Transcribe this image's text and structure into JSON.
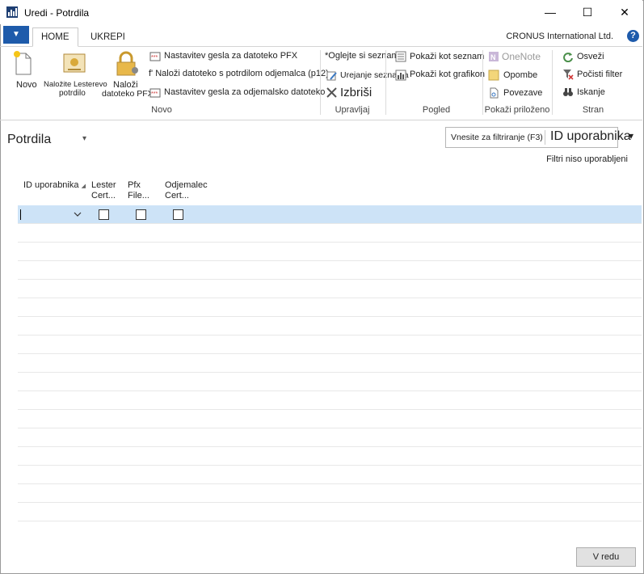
{
  "window": {
    "title": "Uredi - Potrdila",
    "minimize": "—",
    "maximize": "☐",
    "close": "✕"
  },
  "ribbon_tabs": {
    "menu_arrow": "▼",
    "home": "HOME",
    "actions": "UKREPI"
  },
  "company": "CRONUS International Ltd.",
  "help": "?",
  "ribbon": {
    "novo_group": {
      "new": "Novo",
      "upload_lester_1": "Naložite Lesterevo",
      "upload_lester_2": "potrdilo",
      "load_1": "Naloži",
      "load_2": "datoteko PFX",
      "pfx_password": "Nastavitev gesla za datoteko PFX",
      "load_client_file": "f' Naloži datoteko s potrdilom odjemalca (p12)",
      "client_password": "Nastavitev gesla za odjemalsko datoteko",
      "label": "Novo"
    },
    "manage_group": {
      "view_list": "*Oglejte si seznam",
      "edit_list": "Urejanje seznama",
      "delete": "Izbriši",
      "label": "Upravljaj"
    },
    "view_group": {
      "show_list": "Pokaži kot seznam",
      "show_chart": "Pokaži kot grafikon",
      "label": "Pogled"
    },
    "attach_group": {
      "onenote": "OneNote",
      "notes": "Opombe",
      "links": "Povezave",
      "label": "Pokaži priloženo"
    },
    "page_group": {
      "refresh": "Osveži",
      "clear_filter": "Počisti filter",
      "search": "Iskanje",
      "label": "Stran"
    }
  },
  "page": {
    "title": "Potrdila",
    "title_dropdown": "▾",
    "filter_placeholder": "Vnesite za filtriranje (F3)",
    "filter_field": "ID uporabnika",
    "filter_field_arrow": "▾",
    "no_filters": "Filtri niso uporabljeni"
  },
  "table": {
    "columns": [
      {
        "line1": "ID uporabnika",
        "line2": ""
      },
      {
        "line1": "Lester",
        "line2": "Cert..."
      },
      {
        "line1": "Pfx",
        "line2": "File..."
      },
      {
        "line1": "Odjemalec",
        "line2": "Cert..."
      }
    ],
    "rows": [
      {
        "user_id": "",
        "lester_cert": false,
        "pfx_file": false,
        "client_cert": false
      }
    ]
  },
  "footer": {
    "ok": "V redu"
  },
  "colors": {
    "accent": "#1e5bab",
    "selected_row": "#cde3f7"
  }
}
